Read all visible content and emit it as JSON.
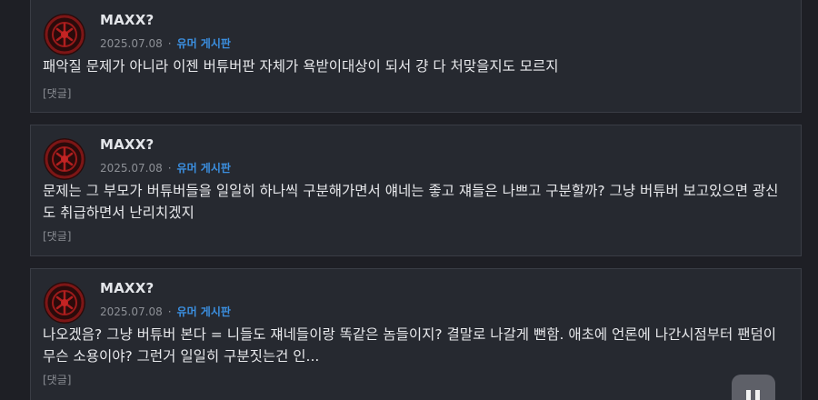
{
  "posts": [
    {
      "author": "MAXX?",
      "date": "2025.07.08",
      "separator": "·",
      "board": "유머 게시판",
      "text": "패악질 문제가 아니라 이젠 버튜버판 자체가 욕받이대상이 되서 걍 다 처맞을지도 모르지",
      "reply": "[댓글]"
    },
    {
      "author": "MAXX?",
      "date": "2025.07.08",
      "separator": "·",
      "board": "유머 게시판",
      "text": "문제는 그 부모가 버튜버들을 일일히 하나씩 구분해가면서 얘네는 좋고 쟤들은 나쁘고 구분할까? 그냥 버튜버 보고있으면 광신도 취급하면서 난리치겠지",
      "reply": "[댓글]"
    },
    {
      "author": "MAXX?",
      "date": "2025.07.08",
      "separator": "·",
      "board": "유머 게시판",
      "text": "나오겠음? 그냥 버튜버 본다 = 니들도 쟤네들이랑 똑같은 놈들이지? 결말로 나갈게 뻔함. 애초에 언론에 나간시점부터 팬덤이 무슨 소용이야? 그런거 일일히 구분짓는건 인...",
      "reply": "[댓글]"
    }
  ],
  "colors": {
    "background": "#1e1f25",
    "card": "#262930",
    "accent": "#3b8fe0",
    "avatar_red": "#8a1414"
  },
  "icons": {
    "avatar": "red-emblem-avatar-icon",
    "media": "pause-icon"
  }
}
